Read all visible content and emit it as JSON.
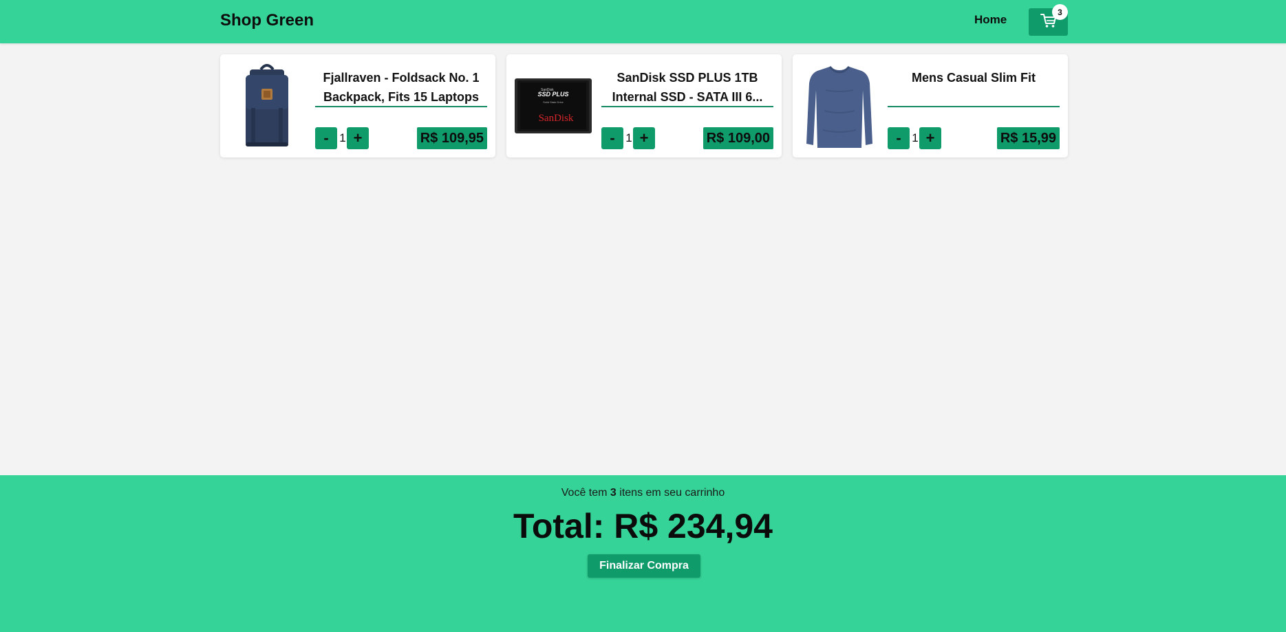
{
  "header": {
    "brand": "Shop Green",
    "nav_home": "Home",
    "cart_count": "3",
    "cart_icon": "cart-icon"
  },
  "cart": {
    "items": [
      {
        "title": "Fjallraven - Foldsack No. 1 Backpack, Fits 15 Laptops",
        "quantity": "1",
        "minus_label": "-",
        "plus_label": "+",
        "price": "R$ 109,95",
        "image": "backpack-image"
      },
      {
        "title": "SanDisk SSD PLUS 1TB Internal SSD - SATA III 6...",
        "quantity": "1",
        "minus_label": "-",
        "plus_label": "+",
        "price": "R$ 109,00",
        "image": "ssd-image",
        "image_text": {
          "top_small": "SanDisk",
          "model": "SSD PLUS",
          "tagline": "Solid State Drive",
          "brand": "SanDisk"
        }
      },
      {
        "title": "Mens Casual Slim Fit",
        "quantity": "1",
        "minus_label": "-",
        "plus_label": "+",
        "price": "R$ 15,99",
        "image": "shirt-image"
      }
    ]
  },
  "footer": {
    "summary_prefix": "Você tem",
    "summary_count": "3",
    "summary_suffix": "itens em seu carrinho",
    "total": "Total: R$ 234,94",
    "checkout_label": "Finalizar Compra"
  },
  "colors": {
    "primary": "#35d398",
    "accent": "#0f9b6a",
    "background": "#f3f3f3"
  }
}
